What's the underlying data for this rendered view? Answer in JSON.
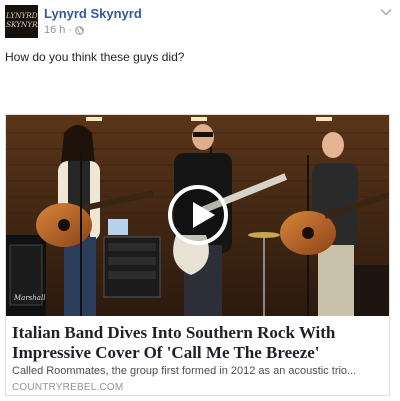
{
  "post": {
    "page_name": "Lynyrd Skynyrd",
    "avatar_text": "LYNYRD SKYNYRD",
    "time": "16 h",
    "separator": "·",
    "message": "How do you think these guys did?"
  },
  "link": {
    "headline": "Italian Band Dives Into Southern Rock With Impressive Cover Of 'Call Me The Breeze'",
    "description": "Called Roommates, the group first formed in 2012 as an acoustic trio...",
    "domain": "COUNTRYREBEL.COM",
    "amp_brand": "Marshall"
  },
  "icons": {
    "privacy": "globe-icon",
    "menu": "chevron-down-icon",
    "play": "play-icon"
  },
  "colors": {
    "name_link": "#365899",
    "meta_text": "#90949c",
    "card_border": "#dddfe2"
  }
}
